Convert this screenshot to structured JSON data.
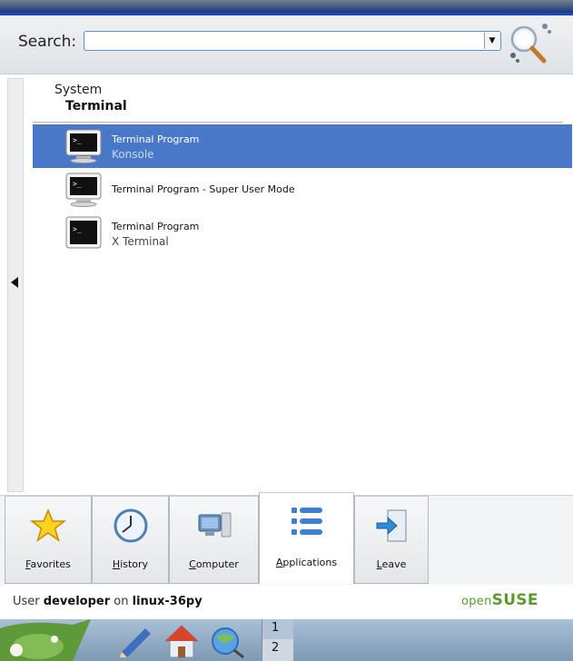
{
  "search": {
    "label": "Search:",
    "value": "",
    "placeholder": ""
  },
  "breadcrumb": {
    "parent": "System",
    "current": "Terminal"
  },
  "items": [
    {
      "name": "Terminal Program",
      "sub": "Konsole",
      "selected": true,
      "icon": "terminal-icon"
    },
    {
      "name": "Terminal Program - Super User Mode",
      "sub": "",
      "selected": false,
      "icon": "terminal-icon"
    },
    {
      "name": "Terminal Program",
      "sub": "X Terminal",
      "selected": false,
      "icon": "terminal-icon"
    }
  ],
  "tabs": [
    {
      "label": "Favorites",
      "icon": "star-icon"
    },
    {
      "label": "History",
      "icon": "clock-icon"
    },
    {
      "label": "Computer",
      "icon": "computer-icon"
    },
    {
      "label": "Applications",
      "icon": "list-icon",
      "active": true
    },
    {
      "label": "Leave",
      "icon": "leave-icon"
    }
  ],
  "status": {
    "prefix": "User",
    "user": "developer",
    "middle": "on",
    "host": "linux-36py"
  },
  "brand": {
    "open": "open",
    "suse": "SUSE"
  },
  "taskbar": {
    "pager": [
      "1",
      "2"
    ],
    "icons": [
      "suse-menu-icon",
      "edit-icon",
      "home-icon",
      "globe-icon"
    ]
  },
  "colors": {
    "selection": "#4a78c9",
    "brand_green": "#5b9b2c",
    "taskbar": "#8aa6c2"
  }
}
